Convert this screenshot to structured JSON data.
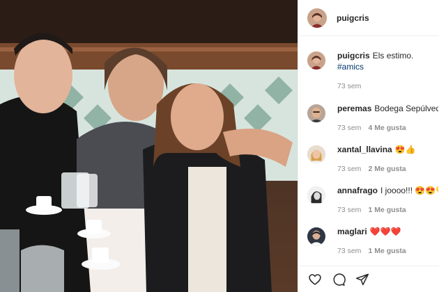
{
  "header": {
    "username": "puigcris"
  },
  "caption": {
    "username": "puigcris",
    "text": "Els estimo.",
    "hashtag": "#amics",
    "time": "73 sem"
  },
  "comments": [
    {
      "username": "peremas",
      "text": "Bodega Sepúlved",
      "time": "73 sem",
      "likes": "4 Me gusta"
    },
    {
      "username": "xantal_llavina",
      "text": "😍👍",
      "time": "73 sem",
      "likes": "2 Me gusta"
    },
    {
      "username": "annafrago",
      "text": "I joooo!!! 😍😍💛",
      "time": "73 sem",
      "likes": "1 Me gusta"
    },
    {
      "username": "maglari",
      "text": "❤️❤️❤️",
      "time": "73 sem",
      "likes": "1 Me gusta"
    }
  ],
  "icons": [
    "heart-icon",
    "comment-icon",
    "share-icon"
  ],
  "colors": {
    "link": "#00376b",
    "meta": "#8e8e8e",
    "border": "#efefef"
  }
}
